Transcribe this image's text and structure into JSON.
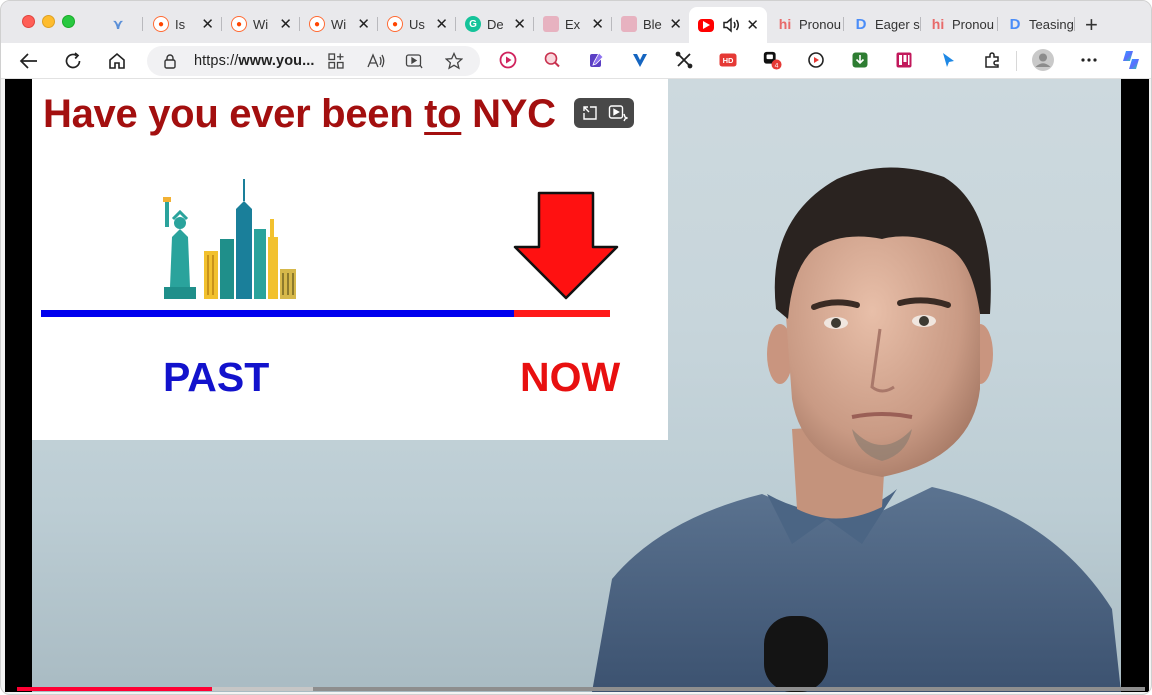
{
  "browser": {
    "tabs": [
      {
        "label": "",
        "icon": "vee-icon"
      },
      {
        "label": "Is",
        "icon": "reddit-icon"
      },
      {
        "label": "Wi",
        "icon": "reddit-icon"
      },
      {
        "label": "Wi",
        "icon": "reddit-icon"
      },
      {
        "label": "Us",
        "icon": "reddit-icon"
      },
      {
        "label": "De",
        "icon": "grammarly-icon"
      },
      {
        "label": "Ex",
        "icon": "pink-app-icon"
      },
      {
        "label": "Ble",
        "icon": "pink-app-icon"
      },
      {
        "label": "",
        "icon": "youtube-icon",
        "active": true
      },
      {
        "label": "Pronou",
        "icon": "hi-icon"
      },
      {
        "label": "Eager s",
        "icon": "d-icon"
      },
      {
        "label": "Pronou",
        "icon": "hi-icon"
      },
      {
        "label": "Teasing",
        "icon": "d-icon"
      }
    ],
    "new_tab_glyph": "+",
    "close_glyph": "✕",
    "address": {
      "scheme": "https://",
      "host": "www.you..."
    }
  },
  "video": {
    "slide": {
      "title_pre": "Have you ever been ",
      "title_underlined": "to",
      "title_post": " NYC",
      "label_past": "PAST",
      "label_now": "NOW"
    },
    "progress": {
      "played_fraction": 0.173,
      "buffered_fraction": 0.262
    }
  },
  "colors": {
    "youtube_red": "#ff0033",
    "slide_title": "#a30f0f",
    "past_blue": "#0000ee",
    "now_red": "#ff1a1a"
  }
}
